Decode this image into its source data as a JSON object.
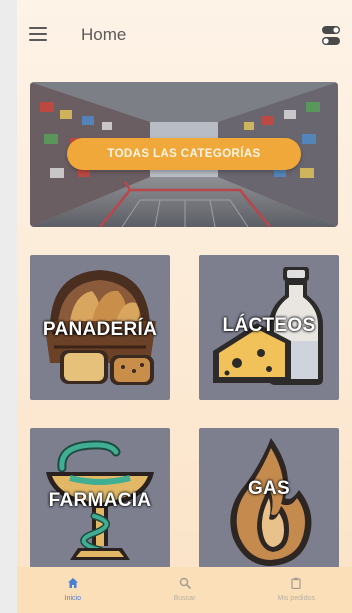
{
  "appbar": {
    "title": "Home"
  },
  "banner": {
    "button_label": "TODAS LAS CATEGORÍAS"
  },
  "categories": [
    {
      "label": "PANADERÍA"
    },
    {
      "label": "LÁCTEOS"
    },
    {
      "label": "FARMACIA"
    },
    {
      "label": "GAS"
    }
  ],
  "bottom_nav": {
    "items": [
      {
        "label": "Inicio",
        "icon": "home-icon",
        "active": true
      },
      {
        "label": "Buscar",
        "icon": "search-icon",
        "active": false
      },
      {
        "label": "Mis pedidos",
        "icon": "clipboard-icon",
        "active": false
      }
    ]
  },
  "colors": {
    "accent": "#f0a83a",
    "card_bg": "#7d7f8f",
    "nav_active": "#4a7fd1",
    "nav_bg": "#fbdfb8"
  }
}
